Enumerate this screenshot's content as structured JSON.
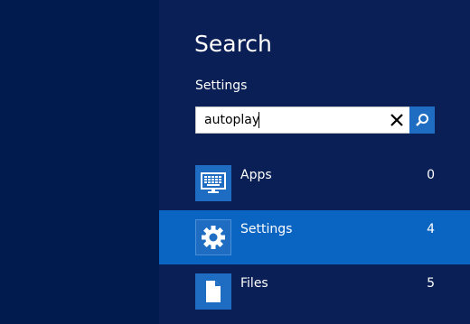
{
  "pane": {
    "title": "Search",
    "scope": "Settings"
  },
  "search": {
    "value": "autoplay",
    "placeholder": ""
  },
  "icons": {
    "clear": "close-icon",
    "search": "search-icon"
  },
  "results": [
    {
      "label": "Apps",
      "count": "0",
      "icon": "apps-icon",
      "selected": false
    },
    {
      "label": "Settings",
      "count": "4",
      "icon": "gear-icon",
      "selected": true
    },
    {
      "label": "Files",
      "count": "5",
      "icon": "file-icon",
      "selected": false
    }
  ],
  "colors": {
    "background": "#011b4e",
    "pane": "#0a1f55",
    "selected": "#0a64c2",
    "accent": "#1e6dc2"
  }
}
